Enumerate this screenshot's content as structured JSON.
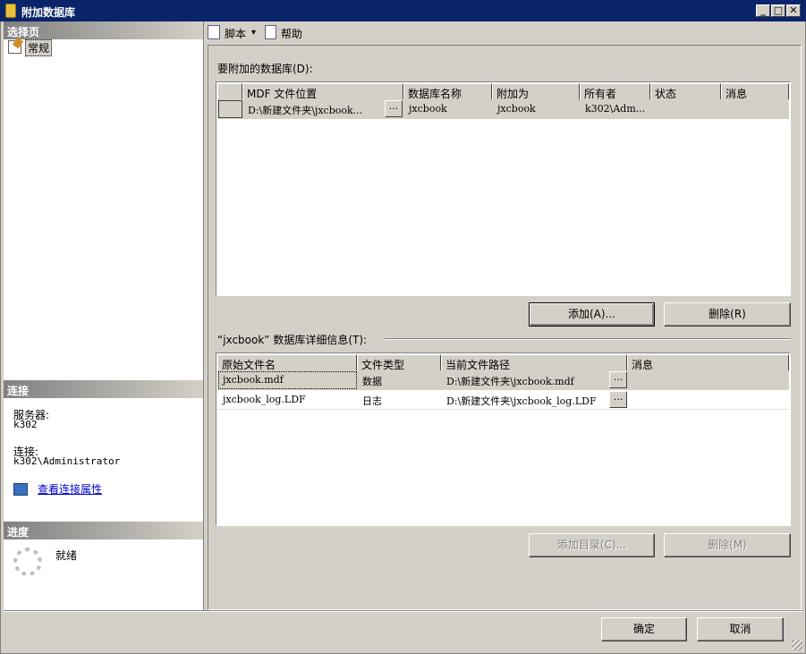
{
  "window": {
    "title": "附加数据库",
    "minimize": "_",
    "maximize": "□",
    "close": "✕"
  },
  "left": {
    "select_page_header": "选择页",
    "pages": [
      {
        "label": "常规"
      }
    ],
    "connection_header": "连接",
    "server_label": "服务器:",
    "server_value": "k302",
    "connection_label": "连接:",
    "connection_value": "k302\\Administrator",
    "view_props_link": "查看连接属性",
    "progress_header": "进度",
    "progress_status": "就绪"
  },
  "toolbar": {
    "script_label": "脚本",
    "script_arrow": "▾",
    "help_label": "帮助"
  },
  "attach": {
    "label": "要附加的数据库(D):",
    "columns": [
      "MDF 文件位置",
      "数据库名称",
      "附加为",
      "所有者",
      "状态",
      "消息"
    ],
    "rows": [
      {
        "mdf": "D:\\新建文件夹\\jxcbook...",
        "dbname": "jxcbook",
        "attach_as": "jxcbook",
        "owner": "k302\\Adm...",
        "status": "",
        "message": ""
      }
    ],
    "ellipsis": "...",
    "add_button": "添加(A)...",
    "remove_button": "删除(R)"
  },
  "details": {
    "label": "“jxcbook” 数据库详细信息(T):",
    "columns": [
      "原始文件名",
      "文件类型",
      "当前文件路径",
      "消息"
    ],
    "rows": [
      {
        "name": "jxcbook.mdf",
        "type": "数据",
        "path": "D:\\新建文件夹\\jxcbook.mdf",
        "message": ""
      },
      {
        "name": "jxcbook_log.LDF",
        "type": "日志",
        "path": "D:\\新建文件夹\\jxcbook_log.LDF",
        "message": ""
      }
    ],
    "ellipsis": "...",
    "add_catalog_button": "添加目录(C)...",
    "remove_button": "删除(M)"
  },
  "footer": {
    "ok_button": "确定",
    "cancel_button": "取消"
  }
}
